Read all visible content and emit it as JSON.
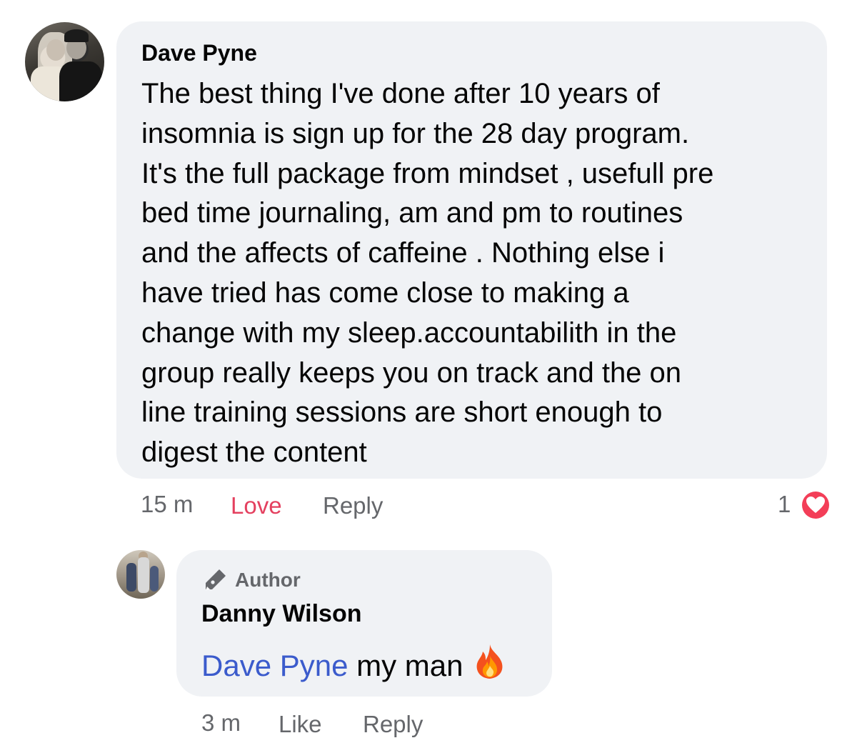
{
  "comment": {
    "author": "Dave Pyne",
    "text": "The best thing I've done after 10 years of\ninsomnia is sign up for the 28 day program.\nIt's the full package from mindset , usefull pre\nbed time journaling, am and pm to routines\nand the affects of caffeine .  Nothing else i\nhave tried has come close to making a\nchange with my sleep.accountabilith in the\ngroup really keeps you on track and the on\nline training sessions are short enough to\ndigest the content",
    "time": "15 m",
    "love_label": "Love",
    "reply_label": "Reply",
    "reaction_count": "1",
    "reaction_icon": "heart-icon"
  },
  "reply": {
    "badge_label": "Author",
    "badge_icon": "pen-icon",
    "author": "Danny Wilson",
    "mention": "Dave Pyne",
    "text": " my man",
    "emoji_icon": "fire-icon",
    "time": "3 m",
    "like_label": "Like",
    "reply_label": "Reply"
  },
  "colors": {
    "bubble_bg": "#f0f2f5",
    "love_color": "#e4405f",
    "mention_color": "#3b5bcc",
    "meta_color": "#65676b",
    "heart_color": "#f33e58"
  }
}
